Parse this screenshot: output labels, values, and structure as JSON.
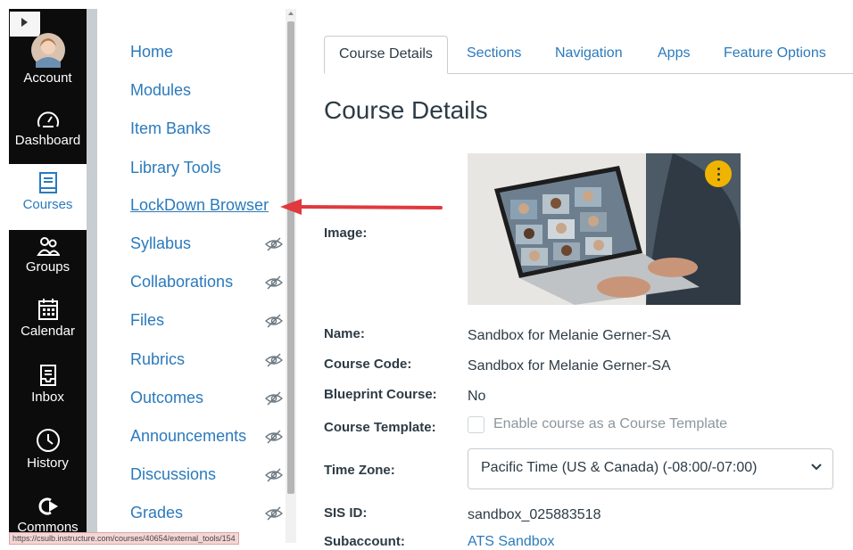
{
  "global_nav": {
    "items": [
      {
        "label": "Account",
        "icon": "avatar"
      },
      {
        "label": "Dashboard",
        "icon": "dashboard-icon"
      },
      {
        "label": "Courses",
        "icon": "courses-icon",
        "active": true
      },
      {
        "label": "Groups",
        "icon": "groups-icon"
      },
      {
        "label": "Calendar",
        "icon": "calendar-icon"
      },
      {
        "label": "Inbox",
        "icon": "inbox-icon"
      },
      {
        "label": "History",
        "icon": "history-icon"
      },
      {
        "label": "Commons",
        "icon": "commons-icon"
      }
    ]
  },
  "course_nav": {
    "items": [
      {
        "label": "Home",
        "hidden": false
      },
      {
        "label": "Modules",
        "hidden": false
      },
      {
        "label": "Item Banks",
        "hidden": false
      },
      {
        "label": "Library Tools",
        "hidden": false
      },
      {
        "label": "LockDown Browser",
        "hidden": false,
        "highlighted": true
      },
      {
        "label": "Syllabus",
        "hidden": true
      },
      {
        "label": "Collaborations",
        "hidden": true
      },
      {
        "label": "Files",
        "hidden": true
      },
      {
        "label": "Rubrics",
        "hidden": true
      },
      {
        "label": "Outcomes",
        "hidden": true
      },
      {
        "label": "Announcements",
        "hidden": true
      },
      {
        "label": "Discussions",
        "hidden": true
      },
      {
        "label": "Grades",
        "hidden": true
      }
    ]
  },
  "tabs": [
    "Course Details",
    "Sections",
    "Navigation",
    "Apps",
    "Feature Options"
  ],
  "page_title": "Course Details",
  "fields": {
    "image_label": "Image:",
    "name_label": "Name:",
    "name_value": "Sandbox for Melanie Gerner-SA",
    "code_label": "Course Code:",
    "code_value": "Sandbox for Melanie Gerner-SA",
    "blueprint_label": "Blueprint Course:",
    "blueprint_value": "No",
    "template_label": "Course Template:",
    "template_checkbox_label": "Enable course as a Course Template",
    "timezone_label": "Time Zone:",
    "timezone_value": "Pacific Time (US & Canada) (-08:00/-07:00)",
    "sis_label": "SIS ID:",
    "sis_value": "sandbox_025883518",
    "subaccount_label": "Subaccount:",
    "subaccount_value": "ATS Sandbox"
  },
  "status_url": "https://csulb.instructure.com/courses/40654/external_tools/154",
  "colors": {
    "link": "#2b7abc",
    "nav_bg": "#0c0c0c",
    "arrow": "#e0393e",
    "kebab": "#f0b400"
  }
}
